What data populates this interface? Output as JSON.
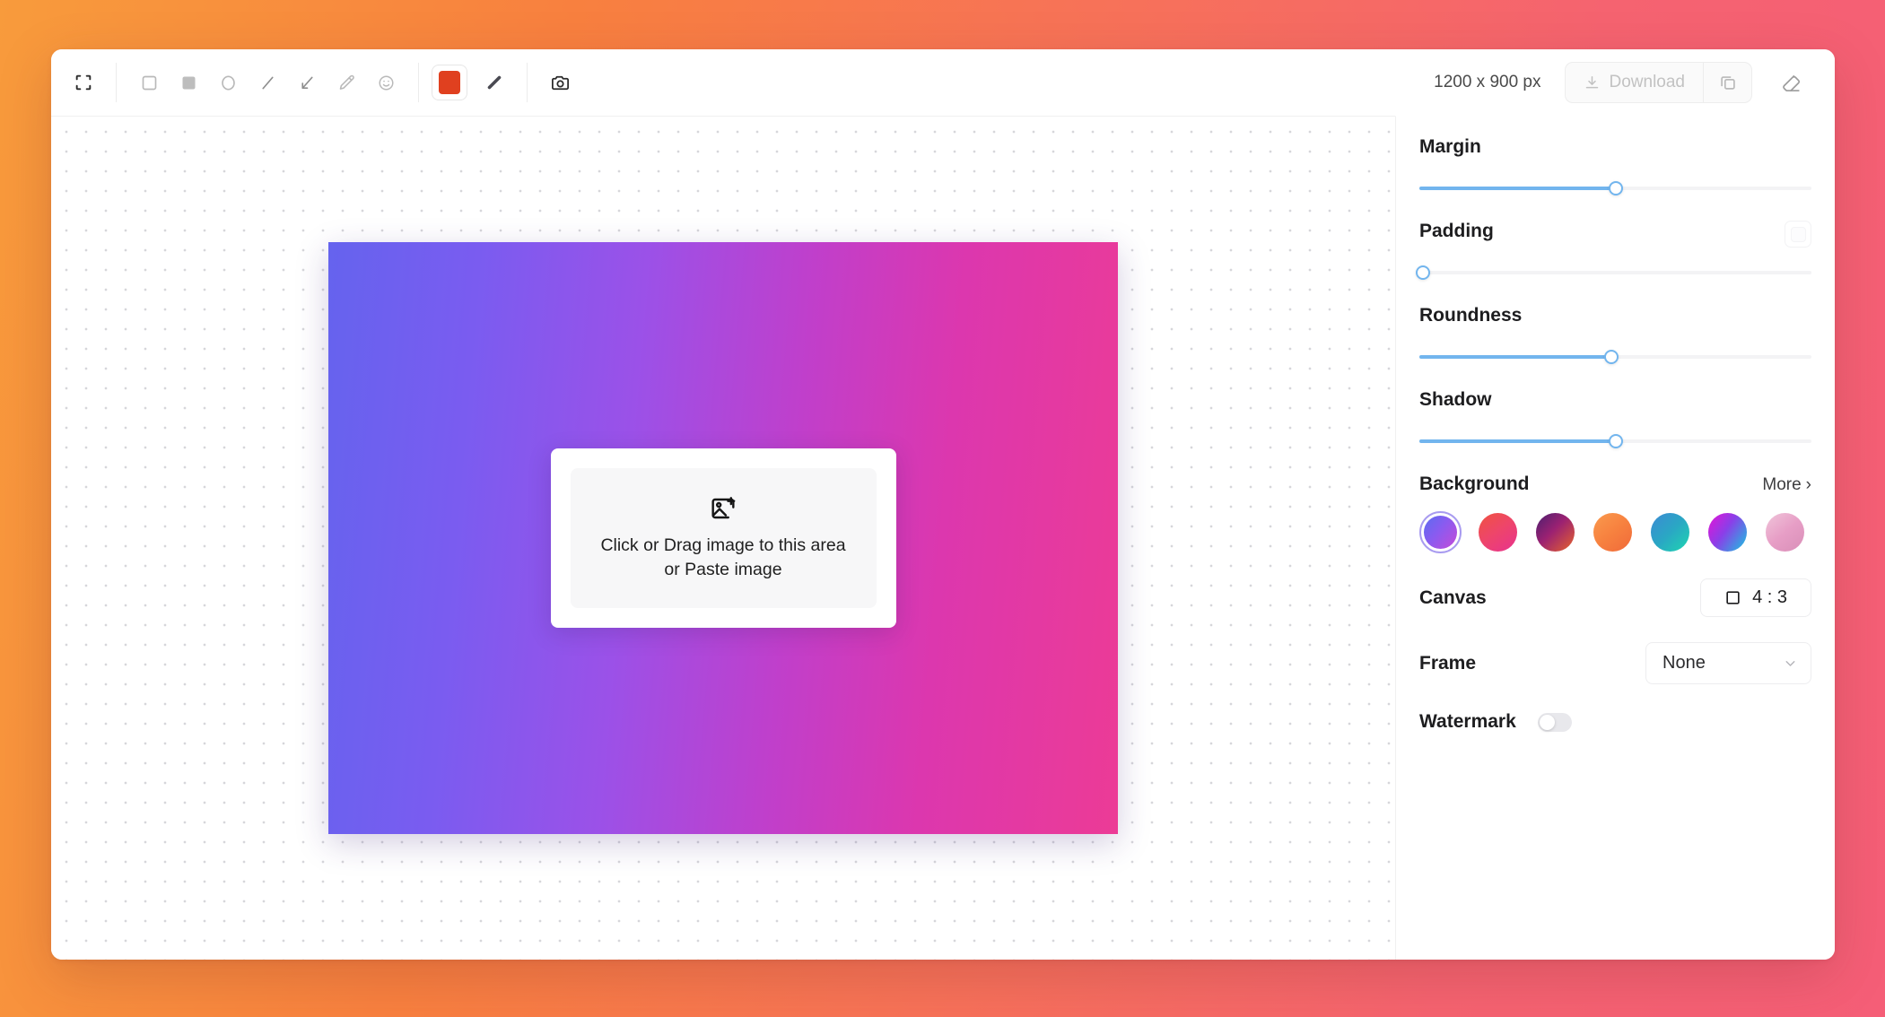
{
  "app": {
    "background_gradient_start": "#F89B3C",
    "background_gradient_end": "#F55E77"
  },
  "toolbar": {
    "tools": [
      {
        "name": "crop-icon",
        "label": "Crop"
      },
      {
        "name": "rectangle-outline-icon",
        "label": "Rectangle"
      },
      {
        "name": "rectangle-filled-icon",
        "label": "Filled rectangle"
      },
      {
        "name": "ellipse-icon",
        "label": "Ellipse"
      },
      {
        "name": "line-icon",
        "label": "Line"
      },
      {
        "name": "arrow-icon",
        "label": "Arrow"
      },
      {
        "name": "pencil-icon",
        "label": "Pencil"
      },
      {
        "name": "emoji-icon",
        "label": "Emoji"
      },
      {
        "name": "camera-icon",
        "label": "Screenshot"
      }
    ],
    "stroke_color": "#E0401F",
    "stroke_color_label": "Stroke color",
    "stroke_width_label": "Stroke width",
    "dimensions": "1200 x 900 px",
    "download_label": "Download",
    "copy_label": "Copy",
    "erase_label": "Erase"
  },
  "canvas": {
    "gradient_start": "#6563EE",
    "gradient_end": "#EC3B96",
    "dropzone": {
      "icon": "image-plus-icon",
      "line1": "Click or Drag image to this area",
      "line2": "or Paste image"
    }
  },
  "sidebar": {
    "sliders": [
      {
        "label": "Margin",
        "value": 50,
        "has_extra_button": false
      },
      {
        "label": "Padding",
        "value": 0,
        "has_extra_button": true
      },
      {
        "label": "Roundness",
        "value": 49,
        "has_extra_button": false
      },
      {
        "label": "Shadow",
        "value": 50,
        "has_extra_button": false
      }
    ],
    "background": {
      "label": "Background",
      "more_label": "More",
      "more_chevron": "›",
      "selected_index": 0,
      "swatches": [
        {
          "name": "swatch-violet-magenta",
          "css": "linear-gradient(130deg, #5B6CF0 0%, #8A5BF0 45%, #C44BD8 100%)"
        },
        {
          "name": "swatch-red-pink",
          "css": "linear-gradient(145deg, #F0523F 0%, #EE4668 45%, #E8338E 100%)"
        },
        {
          "name": "swatch-purple-orange",
          "css": "linear-gradient(135deg, #4B2070 0%, #9B2172 45%, #E8642A 100%)"
        },
        {
          "name": "swatch-orange",
          "css": "linear-gradient(140deg, #FA9A4E 0%, #F7813F 50%, #F06A3A 100%)"
        },
        {
          "name": "swatch-blue-teal",
          "css": "linear-gradient(135deg, #3C8AD4 0%, #2AA7C4 50%, #1ED6B0 100%)"
        },
        {
          "name": "swatch-magenta-cyan",
          "css": "linear-gradient(125deg, #E812D6 0%, #8A3FE8 45%, #17C8E0 100%)"
        },
        {
          "name": "swatch-pink-rose",
          "css": "linear-gradient(140deg, #F0C5DA 0%, #E79EC6 50%, #D98FB8 100%)"
        }
      ]
    },
    "canvas_row": {
      "label": "Canvas",
      "ratio_icon": "square-icon",
      "ratio_value": "4 : 3"
    },
    "frame_row": {
      "label": "Frame",
      "value": "None",
      "chevron": "chevron-down-icon"
    },
    "watermark_row": {
      "label": "Watermark",
      "enabled": false
    }
  }
}
